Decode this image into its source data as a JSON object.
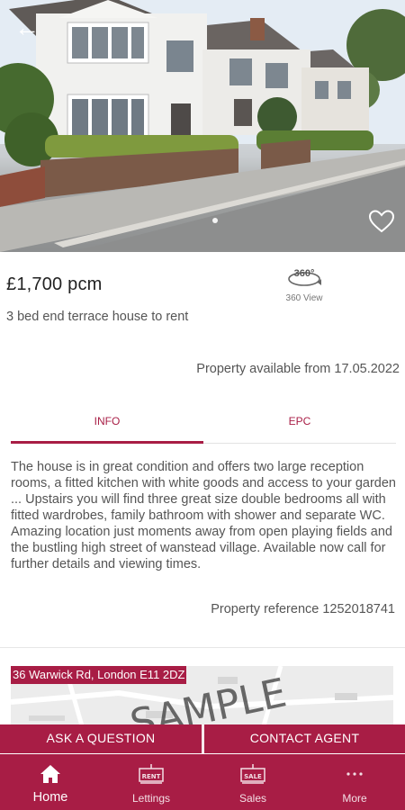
{
  "listing": {
    "price": "£1,700 pcm",
    "subtitle": "3 bed end terrace house to rent",
    "view360_badge": "360°",
    "view360_label": "360 View",
    "available": "Property available from 17.05.2022",
    "description": "The house is in great condition and offers two large reception rooms, a fitted kitchen with white goods and access to your garden ... Upstairs you will find three great size double bedrooms all with fitted wardrobes, family bathroom with shower and separate WC. Amazing location just moments away from open playing fields and the bustling high street of wanstead village. Available now call for further details and viewing times.",
    "reference": "Property reference 1252018741",
    "address": "36 Warwick Rd, London E11 2DZ"
  },
  "tabs": [
    {
      "label": "INFO",
      "active": true
    },
    {
      "label": "EPC",
      "active": false
    }
  ],
  "map": {
    "watermark": "SAMPLE"
  },
  "cta": {
    "ask": "ASK A QUESTION",
    "contact": "CONTACT AGENT"
  },
  "nav": [
    {
      "label": "Home",
      "icon": "home-icon",
      "active": true,
      "badge": ""
    },
    {
      "label": "Lettings",
      "icon": "rent-sign-icon",
      "active": false,
      "badge": "RENT"
    },
    {
      "label": "Sales",
      "icon": "sale-sign-icon",
      "active": false,
      "badge": "SALE"
    },
    {
      "label": "More",
      "icon": "more-dots-icon",
      "active": false,
      "badge": ""
    }
  ],
  "colors": {
    "brand": "#a81d45",
    "text": "#555555",
    "price": "#222222"
  },
  "icons": {
    "back": "back-arrow-icon",
    "favorite": "heart-icon",
    "view360": "360-view-icon"
  }
}
